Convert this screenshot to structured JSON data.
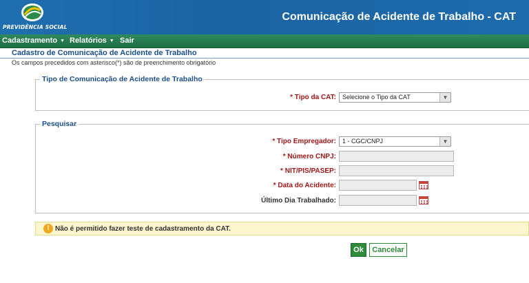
{
  "header": {
    "logo_text": "PREVIDÊNCIA SOCIAL",
    "title": "Comunicação de Acidente de Trabalho - CAT"
  },
  "menu": {
    "items": [
      {
        "label": "Cadastramento",
        "has_dropdown": true
      },
      {
        "label": "Relatórios",
        "has_dropdown": true
      },
      {
        "label": "Sair",
        "has_dropdown": false
      }
    ]
  },
  "page": {
    "title": "Cadastro de Comunicação de Acidente de Trabalho",
    "subtitle": "Os campos precedidos com asterisco(*) são de preenchimento obrigatório"
  },
  "section_tipo": {
    "legend": "Tipo de Comunicação de Acidente de Trabalho",
    "tipo_cat_label": "* Tipo da CAT:",
    "tipo_cat_value": "Selecione o Tipo da CAT"
  },
  "section_pesquisar": {
    "legend": "Pesquisar",
    "tipo_empregador_label": "* Tipo Empregador:",
    "tipo_empregador_value": "1 - CGC/CNPJ",
    "numero_cnpj_label": "* Número CNPJ:",
    "numero_cnpj_value": "",
    "nit_label": "* NIT/PIS/PASEP:",
    "nit_value": "",
    "data_acidente_label": "* Data do Acidente:",
    "data_acidente_value": "",
    "ultimo_dia_label": "Último Dia Trabalhado:",
    "ultimo_dia_value": ""
  },
  "warning": {
    "icon": "!",
    "text": "Não é permitido fazer teste de cadastramento da CAT."
  },
  "buttons": {
    "ok": "Ok",
    "cancel": "Cancelar"
  },
  "colors": {
    "header_blue": "#1d6aaa",
    "menu_green": "#1e6d44",
    "required_red": "#a01818",
    "warning_bg": "#fdf7cf"
  }
}
